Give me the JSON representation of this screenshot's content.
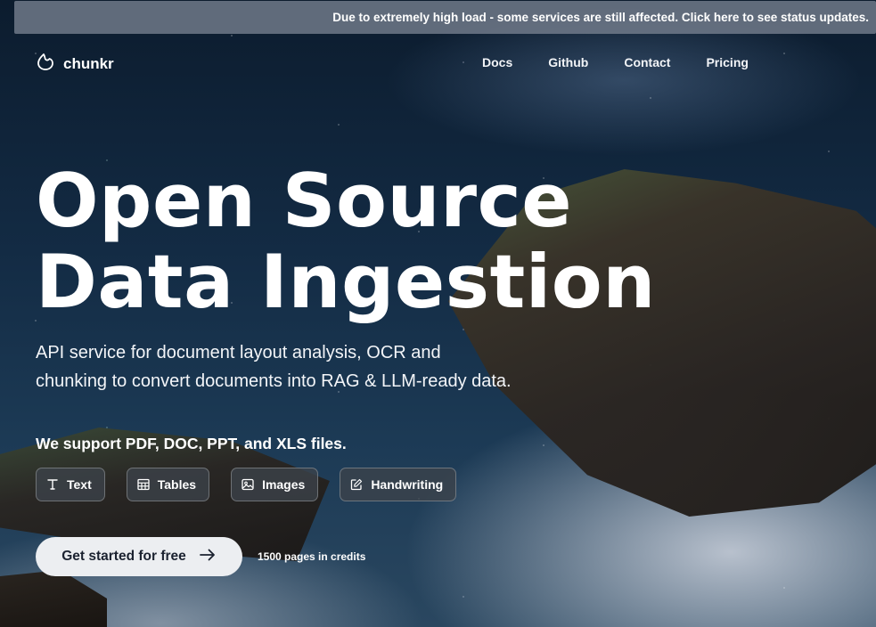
{
  "banner": {
    "text": "Due to extremely high load - some services are still affected. Click here to see status updates."
  },
  "nav": {
    "brand": "chunkr",
    "links": [
      "Docs",
      "Github",
      "Contact",
      "Pricing"
    ]
  },
  "hero": {
    "title_line1": "Open Source",
    "title_line2": "Data Ingestion",
    "subtitle": "API service for document layout analysis, OCR and chunking to convert documents into RAG & LLM-ready data.",
    "support": "We support PDF, DOC, PPT, and XLS files.",
    "chips": [
      {
        "label": "Text",
        "icon": "text-icon"
      },
      {
        "label": "Tables",
        "icon": "table-icon"
      },
      {
        "label": "Images",
        "icon": "image-icon"
      },
      {
        "label": "Handwriting",
        "icon": "edit-icon"
      }
    ],
    "cta_label": "Get started for free",
    "credits": "1500 pages in credits"
  }
}
